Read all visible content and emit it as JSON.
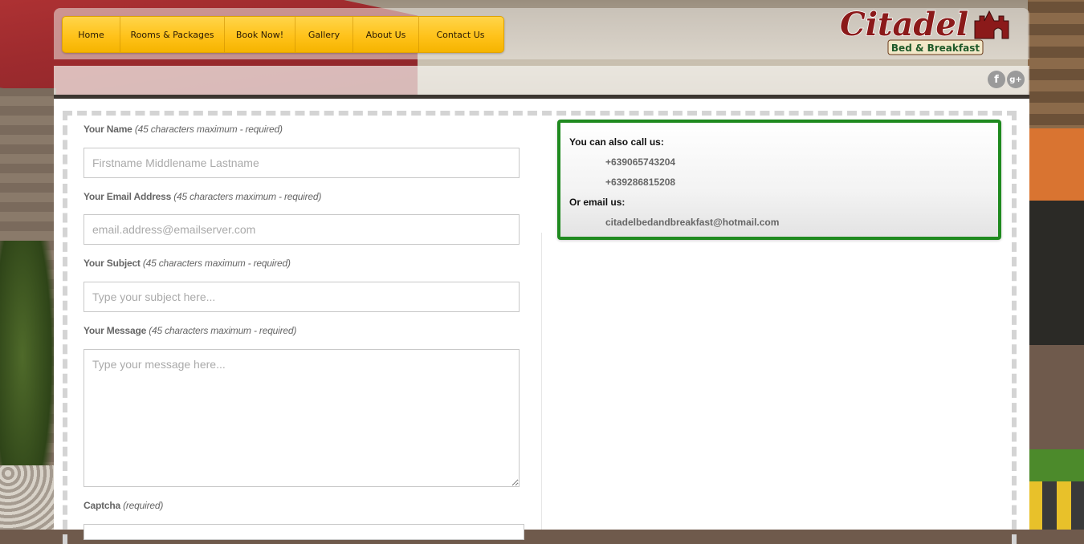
{
  "nav": {
    "items": [
      "Home",
      "Rooms & Packages",
      "Book Now!",
      "Gallery",
      "About Us",
      "Contact Us"
    ]
  },
  "logo": {
    "title": "Citadel",
    "subtitle": "Bed & Breakfast"
  },
  "social": {
    "facebook": "f",
    "googleplus": "g+"
  },
  "form": {
    "name_label": "Your Name",
    "name_hint": "(45 characters maximum - required)",
    "name_placeholder": "Firstname Middlename Lastname",
    "email_label": "Your Email Address",
    "email_hint": "(45 characters maximum - required)",
    "email_placeholder": "email.address@emailserver.com",
    "subject_label": "Your Subject",
    "subject_hint": "(45 characters maximum - required)",
    "subject_placeholder": "Type your subject here...",
    "message_label": "Your Message",
    "message_hint": "(45 characters maximum - required)",
    "message_placeholder": "Type your message here...",
    "captcha_label": "Captcha",
    "captcha_hint": "(required)"
  },
  "contact": {
    "call_heading": "You can also call us:",
    "phones": [
      "+639065743204",
      "+639286815208"
    ],
    "email_heading": "Or email us:",
    "email": "citadelbedandbreakfast@hotmail.com"
  },
  "colors": {
    "nav_yellow": "#ffc21a",
    "contact_border": "#1f8a1f",
    "logo_red": "#8b1a1a",
    "logo_green": "#1f5a2a"
  }
}
